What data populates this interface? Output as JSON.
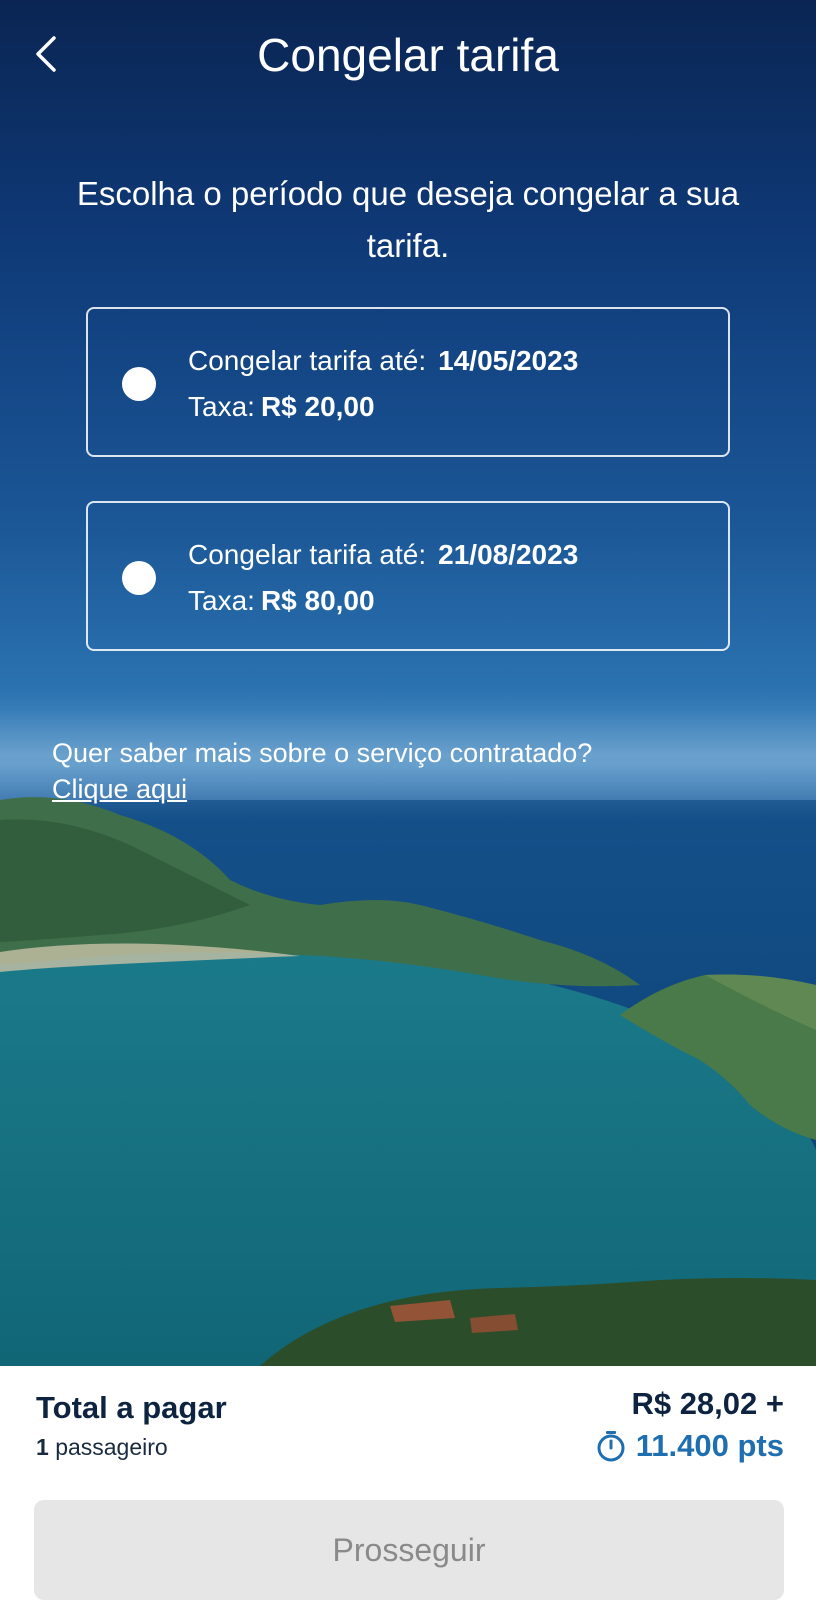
{
  "header": {
    "title": "Congelar tarifa",
    "back_icon": "chevron-left-icon"
  },
  "intro": {
    "text": "Escolha o período que deseja congelar a sua tarifa."
  },
  "options": [
    {
      "label": "Congelar tarifa até:",
      "date": "14/05/2023",
      "fee_label": "Taxa:",
      "fee": "R$ 20,00",
      "selected": false
    },
    {
      "label": "Congelar tarifa até:",
      "date": "21/08/2023",
      "fee_label": "Taxa:",
      "fee": "R$ 80,00",
      "selected": false
    }
  ],
  "info": {
    "question": "Quer saber mais sobre o serviço contratado?",
    "link": "Clique aqui"
  },
  "footer": {
    "total_label": "Total a pagar",
    "passengers_count": "1",
    "passengers_label": "passageiro",
    "price": "R$ 28,02 +",
    "points": "11.400 pts",
    "points_icon": "timer-icon",
    "proceed_label": "Prosseguir"
  },
  "colors": {
    "points_blue": "#1f6fb0",
    "text_dark": "#0d2340",
    "button_disabled_bg": "#e6e6e6",
    "button_disabled_text": "#8a8a8a"
  }
}
